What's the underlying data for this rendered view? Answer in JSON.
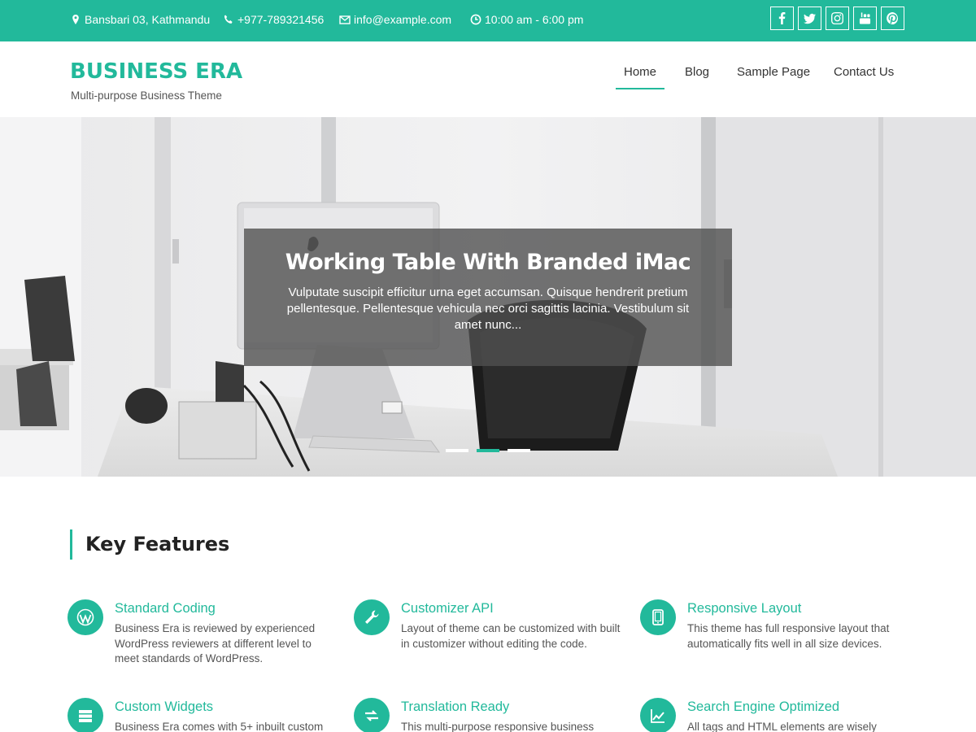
{
  "topbar": {
    "address": "Bansbari 03, Kathmandu",
    "phone": "+977-789321456",
    "email": "info@example.com",
    "hours": "10:00 am - 6:00 pm",
    "socials": [
      "facebook-icon",
      "twitter-icon",
      "instagram-icon",
      "youtube-icon",
      "pinterest-icon"
    ],
    "color": "#22b99b"
  },
  "header": {
    "site_title": "BUSINESS ERA",
    "tagline": "Multi-purpose Business Theme",
    "nav": [
      {
        "label": "Home",
        "active": true
      },
      {
        "label": "Blog",
        "active": false
      },
      {
        "label": "Sample Page",
        "active": false
      },
      {
        "label": "Contact Us",
        "active": false
      }
    ]
  },
  "slider": {
    "title": "Working Table With Branded iMac",
    "text": "Vulputate suscipit efficitur urna eget accumsan. Quisque hendrerit pretium pellentesque. Pellentesque vehicula nec orci sagittis lacinia. Vestibulum sit amet nunc...",
    "slides": 3,
    "active_slide": 2
  },
  "features": {
    "title": "Key Features",
    "items": [
      {
        "icon": "wordpress-icon",
        "title": "Standard Coding",
        "text": "Business Era is reviewed by experienced WordPress reviewers at different level to meet standards of WordPress."
      },
      {
        "icon": "wrench-icon",
        "title": "Customizer API",
        "text": "Layout of theme can be customized with built in customizer without editing the code."
      },
      {
        "icon": "tablet-icon",
        "title": "Responsive Layout",
        "text": "This theme has full responsive layout that automatically fits well in all size devices."
      },
      {
        "icon": "server-icon",
        "title": "Custom Widgets",
        "text": "Business Era comes with 5+ inbuilt custom"
      },
      {
        "icon": "exchange-icon",
        "title": "Translation Ready",
        "text": "This multi-purpose responsive business"
      },
      {
        "icon": "area-chart-icon",
        "title": "Search Engine Optimized",
        "text": "All tags and HTML elements are wisely"
      }
    ]
  }
}
